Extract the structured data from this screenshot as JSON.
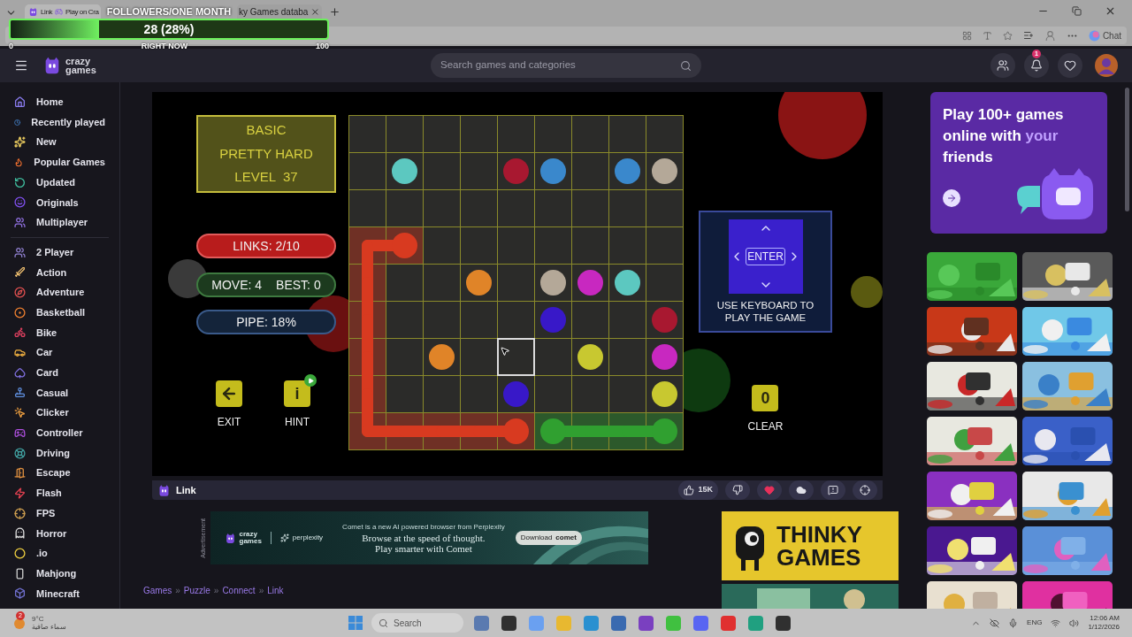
{
  "browser": {
    "tabs": [
      {
        "parts": [
          "Link",
          "Play on Cra"
        ],
        "selected": true
      },
      {
        "parts": [
          "ky Games databa"
        ],
        "selected": false
      }
    ],
    "chat": "Chat"
  },
  "followers_overlay": {
    "title": "FOLLOWERS/ONE MONTH",
    "value": "28 (28%)",
    "level": 0.28,
    "min": "0",
    "current": "RIGHT NOW",
    "max": "100"
  },
  "header": {
    "logo": [
      "crazy",
      "games"
    ],
    "search_placeholder": "Search games and categories",
    "notification_count": "1"
  },
  "sidebar": {
    "primary": [
      "Home",
      "Recently played",
      "New",
      "Popular Games",
      "Updated",
      "Originals",
      "Multiplayer"
    ],
    "categories": [
      "2 Player",
      "Action",
      "Adventure",
      "Basketball",
      "Bike",
      "Car",
      "Card",
      "Casual",
      "Clicker",
      "Controller",
      "Driving",
      "Escape",
      "Flash",
      "FPS",
      "Horror",
      ".io",
      "Mahjong",
      "Minecraft"
    ]
  },
  "game": {
    "level_box": {
      "mode": "BASIC",
      "difficulty": "PRETTY HARD",
      "level_label": "LEVEL",
      "level_number": "37"
    },
    "stats": [
      {
        "kind": "links",
        "parts": [
          "LINKS: 2/10"
        ]
      },
      {
        "kind": "moves",
        "parts": [
          "MOVE: 4",
          "BEST: 0"
        ]
      },
      {
        "kind": "pipe",
        "parts": [
          "PIPE: 18%"
        ]
      }
    ],
    "buttons": [
      {
        "kind": "exit",
        "label": "EXIT"
      },
      {
        "kind": "hint",
        "key": "i",
        "label": "HINT"
      }
    ],
    "keypad": {
      "center": "ENTER",
      "caption": "USE KEYBOARD TO PLAY THE GAME"
    },
    "clear": {
      "key": "0",
      "label": "CLEAR"
    },
    "grid": {
      "rows": [
        {
          "cells": [
            {
              "kind": "empty",
              "selected": false
            },
            {
              "kind": "empty",
              "selected": false
            },
            {
              "kind": "empty",
              "selected": false
            },
            {
              "kind": "empty",
              "selected": false
            },
            {
              "kind": "empty",
              "selected": false
            },
            {
              "kind": "empty",
              "selected": false
            },
            {
              "kind": "empty",
              "selected": false
            },
            {
              "kind": "empty",
              "selected": false
            },
            {
              "kind": "empty",
              "selected": false
            }
          ]
        },
        {
          "cells": [
            {
              "kind": "empty",
              "selected": false
            },
            {
              "kind": "dot",
              "color": "#5cc8c0",
              "selected": false
            },
            {
              "kind": "empty",
              "selected": false
            },
            {
              "kind": "empty",
              "selected": false
            },
            {
              "kind": "dot",
              "color": "#a81830",
              "selected": false
            },
            {
              "kind": "dot",
              "color": "#3a88cc",
              "selected": false
            },
            {
              "kind": "empty",
              "selected": false
            },
            {
              "kind": "dot",
              "color": "#3a88cc",
              "selected": false
            },
            {
              "kind": "dot",
              "color": "#b4a898",
              "selected": false
            }
          ]
        },
        {
          "cells": [
            {
              "kind": "empty",
              "selected": false
            },
            {
              "kind": "empty",
              "selected": false
            },
            {
              "kind": "empty",
              "selected": false
            },
            {
              "kind": "empty",
              "selected": false
            },
            {
              "kind": "empty",
              "selected": false
            },
            {
              "kind": "empty",
              "selected": false
            },
            {
              "kind": "empty",
              "selected": false
            },
            {
              "kind": "empty",
              "selected": false
            },
            {
              "kind": "empty",
              "selected": false
            }
          ]
        },
        {
          "cells": [
            {
              "kind": "empty",
              "pipe": {
                "color": "#d83a20"
              },
              "selected": false
            },
            {
              "kind": "dot",
              "color": "#d83a20",
              "pipe": {
                "color": "#d83a20"
              },
              "selected": false
            },
            {
              "kind": "empty",
              "selected": false
            },
            {
              "kind": "empty",
              "selected": false
            },
            {
              "kind": "empty",
              "selected": false
            },
            {
              "kind": "empty",
              "selected": false
            },
            {
              "kind": "empty",
              "selected": false
            },
            {
              "kind": "empty",
              "selected": false
            },
            {
              "kind": "empty",
              "selected": false
            }
          ]
        },
        {
          "cells": [
            {
              "kind": "empty",
              "pipe": {
                "color": "#d83a20"
              },
              "selected": false
            },
            {
              "kind": "empty",
              "selected": false
            },
            {
              "kind": "empty",
              "selected": false
            },
            {
              "kind": "dot",
              "color": "#e08428",
              "selected": false
            },
            {
              "kind": "empty",
              "selected": false
            },
            {
              "kind": "dot",
              "color": "#b4a898",
              "selected": false
            },
            {
              "kind": "dot",
              "color": "#c828c0",
              "selected": false
            },
            {
              "kind": "dot",
              "color": "#5cc8c0",
              "selected": false
            },
            {
              "kind": "empty",
              "selected": false
            }
          ]
        },
        {
          "cells": [
            {
              "kind": "empty",
              "pipe": {
                "color": "#d83a20"
              },
              "selected": false
            },
            {
              "kind": "empty",
              "selected": false
            },
            {
              "kind": "empty",
              "selected": false
            },
            {
              "kind": "empty",
              "selected": false
            },
            {
              "kind": "empty",
              "selected": false
            },
            {
              "kind": "dot",
              "color": "#3818c8",
              "selected": false
            },
            {
              "kind": "empty",
              "selected": false
            },
            {
              "kind": "empty",
              "selected": false
            },
            {
              "kind": "dot",
              "color": "#a81830",
              "selected": false
            }
          ]
        },
        {
          "cells": [
            {
              "kind": "empty",
              "pipe": {
                "color": "#d83a20"
              },
              "selected": false
            },
            {
              "kind": "empty",
              "selected": false
            },
            {
              "kind": "dot",
              "color": "#e08428",
              "selected": false
            },
            {
              "kind": "empty",
              "selected": false
            },
            {
              "kind": "empty",
              "selected": true
            },
            {
              "kind": "empty",
              "selected": false
            },
            {
              "kind": "dot",
              "color": "#c8c830",
              "selected": false
            },
            {
              "kind": "empty",
              "selected": false
            },
            {
              "kind": "dot",
              "color": "#c828c0",
              "selected": false
            }
          ]
        },
        {
          "cells": [
            {
              "kind": "empty",
              "pipe": {
                "color": "#d83a20"
              },
              "selected": false
            },
            {
              "kind": "empty",
              "selected": false
            },
            {
              "kind": "empty",
              "selected": false
            },
            {
              "kind": "empty",
              "selected": false
            },
            {
              "kind": "dot",
              "color": "#3818c8",
              "selected": false
            },
            {
              "kind": "empty",
              "selected": false
            },
            {
              "kind": "empty",
              "selected": false
            },
            {
              "kind": "empty",
              "selected": false
            },
            {
              "kind": "dot",
              "color": "#c8c830",
              "selected": false
            }
          ]
        },
        {
          "cells": [
            {
              "kind": "empty",
              "pipe": {
                "color": "#d83a20"
              },
              "selected": false
            },
            {
              "kind": "empty",
              "pipe": {
                "color": "#d83a20"
              },
              "selected": false
            },
            {
              "kind": "empty",
              "pipe": {
                "color": "#d83a20"
              },
              "selected": false
            },
            {
              "kind": "empty",
              "pipe": {
                "color": "#d83a20"
              },
              "selected": false
            },
            {
              "kind": "dot",
              "color": "#d83a20",
              "pipe": {
                "color": "#d83a20"
              },
              "selected": false
            },
            {
              "kind": "dot",
              "color": "#30a030",
              "pipe": {
                "color": "#30a030"
              },
              "selected": false
            },
            {
              "kind": "empty",
              "pipe": {
                "color": "#30a030"
              },
              "selected": false
            },
            {
              "kind": "empty",
              "pipe": {
                "color": "#30a030"
              },
              "selected": false
            },
            {
              "kind": "dot",
              "color": "#30a030",
              "pipe": {
                "color": "#30a030"
              },
              "selected": false
            }
          ]
        }
      ]
    }
  },
  "game_bar": {
    "title": "Link",
    "likes": "15K",
    "liked": true
  },
  "ad": {
    "label": "Advertisement",
    "logo": [
      "crazy",
      "games"
    ],
    "partner": "perplexity",
    "tagline": "Comet is a new AI powered browser from Perplexity",
    "headline": [
      "Browse at the speed of thought.",
      "Play smarter with Comet"
    ],
    "cta": [
      "Download",
      "comet"
    ]
  },
  "side_ad": {
    "text": [
      "THINKY",
      "GAMES"
    ]
  },
  "breadcrumb": {
    "items": [
      "Games",
      "Puzzle",
      "Connect",
      "Link"
    ],
    "separator": "»"
  },
  "promo": {
    "title_parts": [
      {
        "text": "Play 100+ games online with ",
        "highlight": false
      },
      {
        "text": "your",
        "highlight": true
      },
      {
        "text": " friends",
        "highlight": false
      }
    ]
  },
  "taskbar": {
    "weather": {
      "temp": "9°C",
      "condition": "سماء صافية",
      "badge": "2"
    },
    "search": "Search",
    "language": "ENG",
    "time": "12:06 AM",
    "date": "1/12/2026"
  }
}
